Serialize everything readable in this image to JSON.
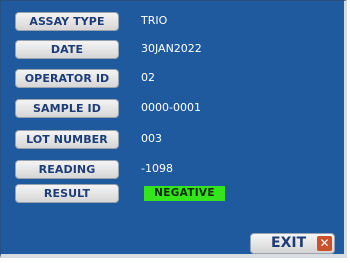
{
  "fields": [
    {
      "label": "ASSAY TYPE",
      "value": "TRIO"
    },
    {
      "label": "DATE",
      "value": "30JAN2022"
    },
    {
      "label": "OPERATOR ID",
      "value": "02"
    },
    {
      "label": "SAMPLE ID",
      "value": "0000-0001"
    },
    {
      "label": "LOT NUMBER",
      "value": "003"
    },
    {
      "label": "READING",
      "value": "-1098"
    }
  ],
  "result": {
    "label": "RESULT",
    "value": "NEGATIVE",
    "color": "#34e51d"
  },
  "exit": {
    "label": "EXIT",
    "icon": "close-icon"
  },
  "colors": {
    "background": "#1f5a9e",
    "label_text": "#1d3d78",
    "exit_icon_bg": "#c8522b"
  }
}
